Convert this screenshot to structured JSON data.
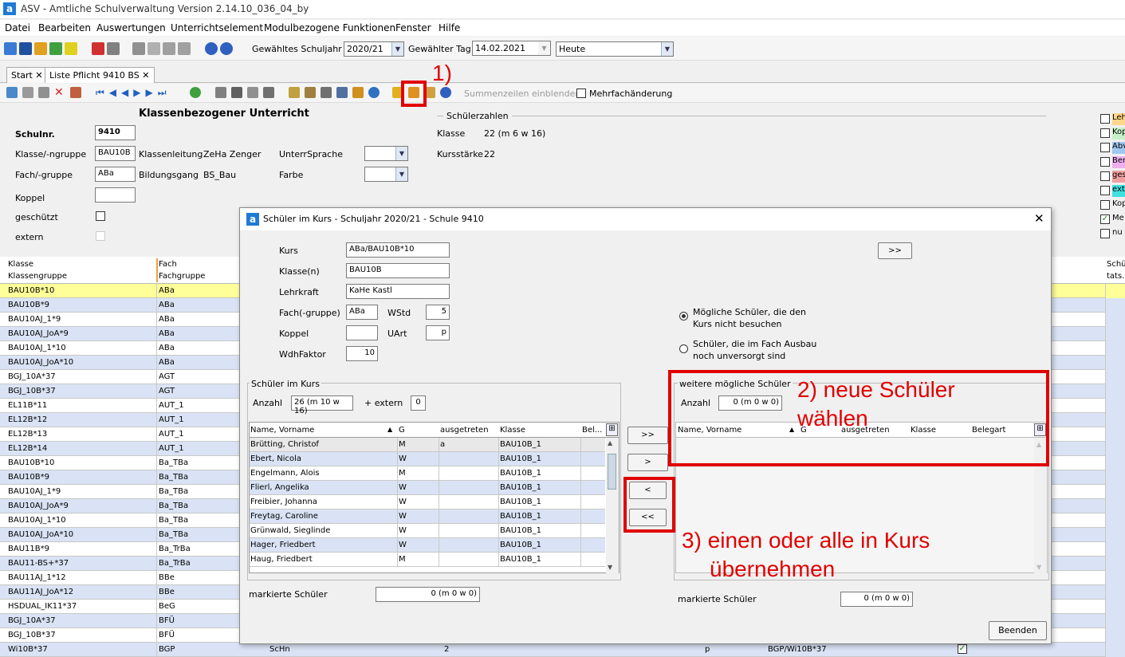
{
  "window": {
    "title": "ASV - Amtliche Schulverwaltung Version 2.14.10_036_04_by",
    "icon": "a"
  },
  "menu": [
    "Datei",
    "Bearbeiten",
    "Auswertungen",
    "Unterrichtselement",
    "Modulbezogene Funktionen",
    "Fenster",
    "Hilfe"
  ],
  "toolbar": {
    "schuljahr_label": "Gewähltes Schuljahr",
    "schuljahr_value": "2020/21",
    "tag_label": "Gewählter Tag",
    "tag_value": "14.02.2021",
    "heute_value": "Heute"
  },
  "tabs": [
    {
      "label": "Start"
    },
    {
      "label": "Liste Pflicht 9410 BS"
    }
  ],
  "toolbar2": {
    "summenzeilen": "Summenzeilen einblenden",
    "mehrfach": "Mehrfachänderung"
  },
  "annotations": {
    "a1": "1)",
    "a2_line1": "2) neue Schüler",
    "a2_line2": "wählen",
    "a3_line1": "3) einen oder alle in Kurs",
    "a3_line2": "übernehmen"
  },
  "form": {
    "heading": "Klassenbezogener Unterricht",
    "schulnr_label": "Schulnr.",
    "schulnr": "9410",
    "klasse_label": "Klasse/-ngruppe",
    "klasse": "BAU10B",
    "klassenleitung_label": "Klassenleitung",
    "klassenleitung": "ZeHa Zenger",
    "fach_label": "Fach/-gruppe",
    "fach": "ABa",
    "bildungsgang_label": "Bildungsgang",
    "bildungsgang": "BS_Bau",
    "koppel_label": "Koppel",
    "geschuetzt_label": "geschützt",
    "extern_label": "extern",
    "unterrsprache_label": "UnterrSprache",
    "farbe_label": "Farbe",
    "schuelerzahlen_label": "Schülerzahlen",
    "klasse_sz_label": "Klasse",
    "klasse_sz": "22 (m 6 w 16)",
    "kursstaerke_label": "Kursstärke",
    "kursstaerke": "22"
  },
  "legend": [
    {
      "label": "Leh",
      "color": "#ffd78a",
      "checked": false
    },
    {
      "label": "Kop",
      "color": "#c8f0c8",
      "checked": false
    },
    {
      "label": "Abv",
      "color": "#a0c8f0",
      "checked": false
    },
    {
      "label": "Ber",
      "color": "#f0b0f0",
      "checked": false
    },
    {
      "label": "ges",
      "color": "#f0a0a0",
      "checked": false
    },
    {
      "label": "ext",
      "color": "#40e0e0",
      "checked": false
    },
    {
      "label": "Kop",
      "color": "#f0f0f0",
      "checked": false
    },
    {
      "label": "Me",
      "color": "#f0f0f0",
      "checked": true
    },
    {
      "label": "nu",
      "color": "#f0f0f0",
      "checked": false
    }
  ],
  "grid": {
    "col1a": "Klasse",
    "col1b": "Klassengruppe",
    "col2a": "Fach",
    "col2b": "Fachgruppe",
    "right_col_a": "Schü",
    "right_col_b": "tats.",
    "rows": [
      [
        "BAU10B*10",
        "ABa"
      ],
      [
        "BAU10B*9",
        "ABa"
      ],
      [
        "BAU10AJ_1*9",
        "ABa"
      ],
      [
        "BAU10AJ_JoA*9",
        "ABa"
      ],
      [
        "BAU10AJ_1*10",
        "ABa"
      ],
      [
        "BAU10AJ_JoA*10",
        "ABa"
      ],
      [
        "BGJ_10A*37",
        "AGT"
      ],
      [
        "BGJ_10B*37",
        "AGT"
      ],
      [
        "EL11B*11",
        "AUT_1"
      ],
      [
        "EL12B*12",
        "AUT_1"
      ],
      [
        "EL12B*13",
        "AUT_1"
      ],
      [
        "EL12B*14",
        "AUT_1"
      ],
      [
        "BAU10B*10",
        "Ba_TBa"
      ],
      [
        "BAU10B*9",
        "Ba_TBa"
      ],
      [
        "BAU10AJ_1*9",
        "Ba_TBa"
      ],
      [
        "BAU10AJ_JoA*9",
        "Ba_TBa"
      ],
      [
        "BAU10AJ_1*10",
        "Ba_TBa"
      ],
      [
        "BAU10AJ_JoA*10",
        "Ba_TBa"
      ],
      [
        "BAU11B*9",
        "Ba_TrBa"
      ],
      [
        "BAU11-BS+*37",
        "Ba_TrBa"
      ],
      [
        "BAU11AJ_1*12",
        "BBe"
      ],
      [
        "BAU11AJ_JoA*12",
        "BBe"
      ],
      [
        "HSDUAL_IK11*37",
        "BeG"
      ],
      [
        "BGJ_10A*37",
        "BFÜ"
      ],
      [
        "BGJ_10B*37",
        "BFÜ"
      ],
      [
        "Wi10B*37",
        "BGP"
      ]
    ],
    "last_row_extra": {
      "c3": "ScHn",
      "c4": "2",
      "c5": "p",
      "c6": "BGP/Wi10B*37"
    }
  },
  "dialog": {
    "title": "Schüler im Kurs - Schuljahr 2020/21 - Schule 9410",
    "kurs_label": "Kurs",
    "kurs": "ABa/BAU10B*10",
    "klassen_label": "Klasse(n)",
    "klassen": "BAU10B",
    "lehrkraft_label": "Lehrkraft",
    "lehrkraft": "KaHe Kastl",
    "fach_label": "Fach(-gruppe)",
    "fach": "ABa",
    "wstd_label": "WStd",
    "wstd": "5",
    "koppel_label": "Koppel",
    "uart_label": "UArt",
    "uart": "p",
    "wdh_label": "WdhFaktor",
    "wdh": "10",
    "radio1_line1": "Mögliche Schüler, die den",
    "radio1_line2": "Kurs nicht besuchen",
    "radio2_line1": "Schüler, die im Fach Ausbau",
    "radio2_line2": "noch unversorgt sind",
    "sik_label": "Schüler im Kurs",
    "anzahl_label": "Anzahl",
    "anzahl": "26 (m 10 w 16)",
    "extern_label": "+ extern",
    "extern": "0",
    "weitere_label": "weitere mögliche Schüler",
    "anzahl2": "0 (m 0 w 0)",
    "markierte_label": "markierte Schüler",
    "markierte_left": "0 (m 0 w 0)",
    "markierte_right": "0 (m 0 w 0)",
    "btn_top": ">>",
    "btn_addall": ">>",
    "btn_add": ">",
    "btn_remove": "<",
    "btn_removeall": "<<",
    "btn_beenden": "Beenden",
    "cols_left": [
      "Name, Vorname",
      "G",
      "ausgetreten",
      "Klasse",
      "Bel..."
    ],
    "cols_right": [
      "Name, Vorname",
      "G",
      "ausgetreten",
      "Klasse",
      "Belegart"
    ],
    "students": [
      [
        "Brütting, Christof",
        "M",
        "a",
        "BAU10B_1"
      ],
      [
        "Ebert, Nicola",
        "W",
        "",
        "BAU10B_1"
      ],
      [
        "Engelmann, Alois",
        "M",
        "",
        "BAU10B_1"
      ],
      [
        "Flierl, Angelika",
        "W",
        "",
        "BAU10B_1"
      ],
      [
        "Freibier, Johanna",
        "W",
        "",
        "BAU10B_1"
      ],
      [
        "Freytag, Caroline",
        "W",
        "",
        "BAU10B_1"
      ],
      [
        "Grünwald, Sieglinde",
        "W",
        "",
        "BAU10B_1"
      ],
      [
        "Hager, Friedbert",
        "W",
        "",
        "BAU10B_1"
      ],
      [
        "Haug, Friedbert",
        "M",
        "",
        "BAU10B_1"
      ]
    ]
  }
}
